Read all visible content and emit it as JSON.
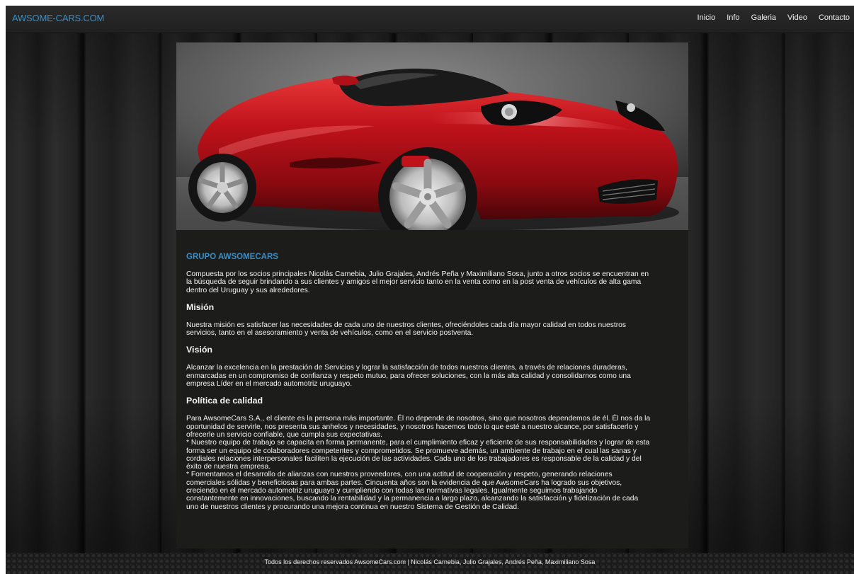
{
  "navbar": {
    "brand": "AWSOME-CARS.COM",
    "links": [
      "Inicio",
      "Info",
      "Galeria",
      "Video",
      "Contacto"
    ]
  },
  "hero": {
    "image": "red-sports-car"
  },
  "content": {
    "heading": "GRUPO AWSOMECARS",
    "intro": "Compuesta por los socios principales Nicolás Carnebia, Julio Grajales, Andrés Peña y Maximiliano Sosa, junto a otros socios se encuentran en\nla búsqueda de seguir brindando a sus clientes y amigos el mejor servicio tanto en la venta como en la post venta de vehículos de alta gama\ndentro del Uruguay y sus alrededores.",
    "sections": [
      {
        "title": "Misión",
        "text": "Nuestra misión es satisfacer las necesidades de cada uno de nuestros clientes, ofreciéndoles cada día mayor calidad en todos nuestros\nservicios, tanto en el asesoramiento y venta de vehículos, como en el servicio postventa."
      },
      {
        "title": "Visión",
        "text": "Alcanzar la excelencia en la prestación de Servicios y lograr la satisfacción de todos nuestros clientes, a través de relaciones duraderas,\nenmarcadas en un compromiso de confianza y respeto mutuo, para ofrecer soluciones, con la más alta calidad y consolidarnos como una\nempresa Líder en el mercado automotriz uruguayo."
      },
      {
        "title": "Política de calidad",
        "text": "Para AwsomeCars S.A., el cliente es la persona más importante. Él no depende de nosotros, sino que nosotros dependemos de él. Él nos da la\noportunidad de servirle, nos presenta sus anhelos y necesidades, y nosotros hacemos todo lo que esté a nuestro alcance, por satisfacerlo y\nofrecerle un servicio confiable, que cumpla sus expectativas.\n* Nuestro equipo de trabajo se capacita en forma permanente, para el cumplimiento eficaz y eficiente de sus responsabilidades y lograr de esta\nforma ser un equipo de colaboradores competentes y comprometidos. Se promueve además, un ambiente de trabajo en el cual las sanas y\ncordiales relaciones interpersonales faciliten la ejecución de las actividades. Cada uno de los trabajadores es responsable de la calidad y del\néxito de nuestra empresa.\n* Fomentamos el desarrollo de alianzas con nuestros proveedores, con una actitud de cooperación y respeto, generando relaciones\ncomerciales sólidas y beneficiosas para ambas partes. Cincuenta años son la evidencia de que AwsomeCars ha logrado sus objetivos,\ncreciendo en el mercado automotriz uruguayo y cumpliendo con todas las normativas legales. Igualmente seguimos trabajando\nconstantemente en innovaciones, buscando la rentabilidad y la permanencia a largo plazo, alcanzando la satisfacción y fidelización de cada\nuno de nuestros clientes y procurando una mejora continua en nuestro Sistema de Gestión de Calidad."
      }
    ]
  },
  "footer": {
    "text": "Todos los derechos reservados AwsomeCars.com | Nicolás Carnebia, Julio Grajales, Andrés Peña, Maximiliano Sosa"
  },
  "colors": {
    "accent": "#3a8ec4",
    "car_red": "#c0121b",
    "content_bg": "#1c1c1a"
  }
}
